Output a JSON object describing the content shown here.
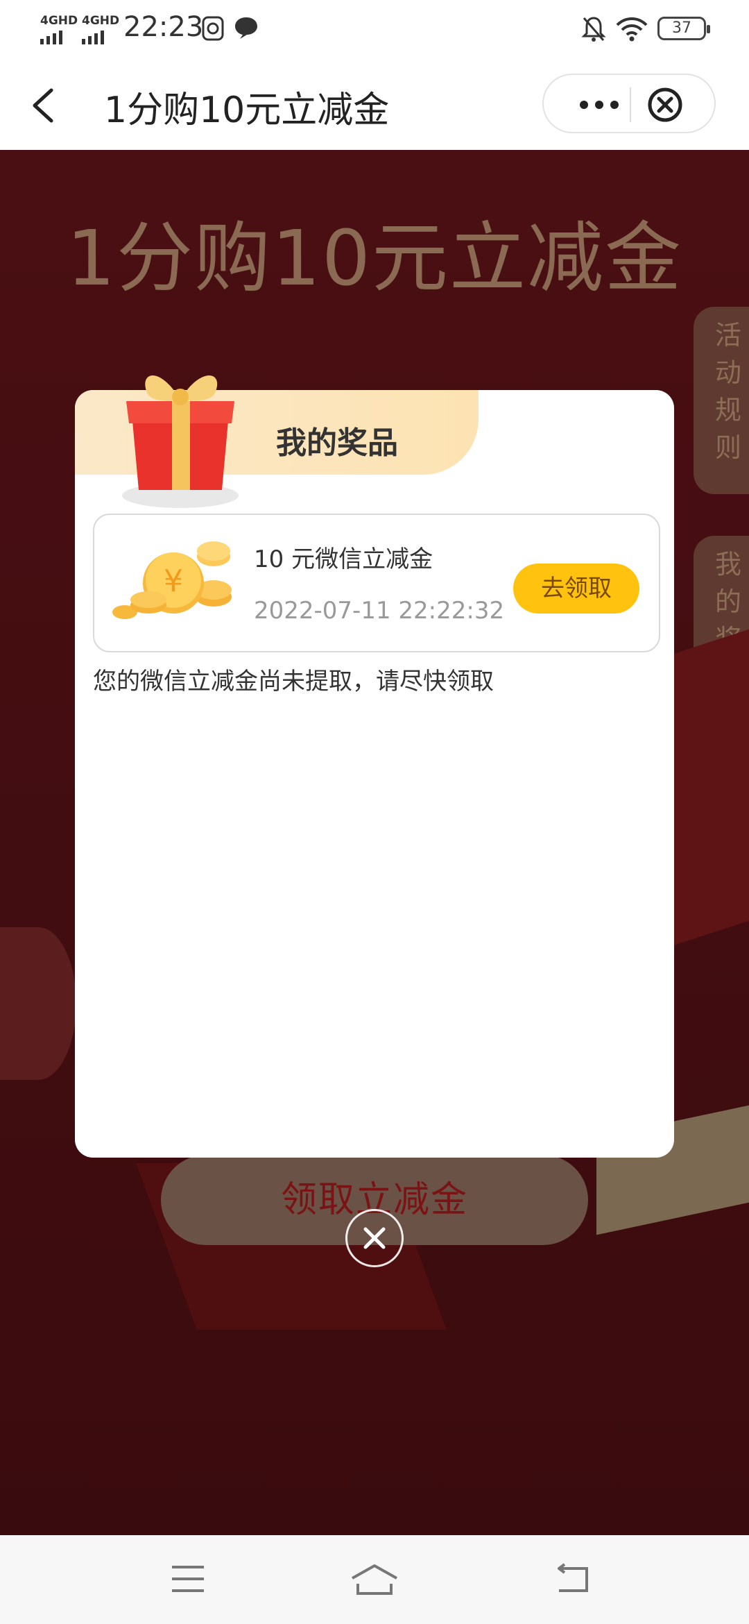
{
  "status_bar": {
    "sim1": "4GHD",
    "sim2": "4GHD",
    "time": "22:23",
    "battery": "37"
  },
  "nav": {
    "title": "1分购10元立减金"
  },
  "background": {
    "title": "1分购10元立减金",
    "side_tabs": [
      {
        "label": "活\n动\n规\n则"
      },
      {
        "label": "我\n的\n奖\n品"
      }
    ],
    "main_button": "领取立减金"
  },
  "modal": {
    "title": "我的奖品",
    "prize": {
      "name": "10 元微信立减金",
      "time": "2022-07-11 22:22:32",
      "claim_label": "去领取"
    },
    "note": "您的微信立减金尚未提取，请尽快领取"
  },
  "colors": {
    "claim_button": "#ffc20e",
    "background": "#4a0f13"
  }
}
